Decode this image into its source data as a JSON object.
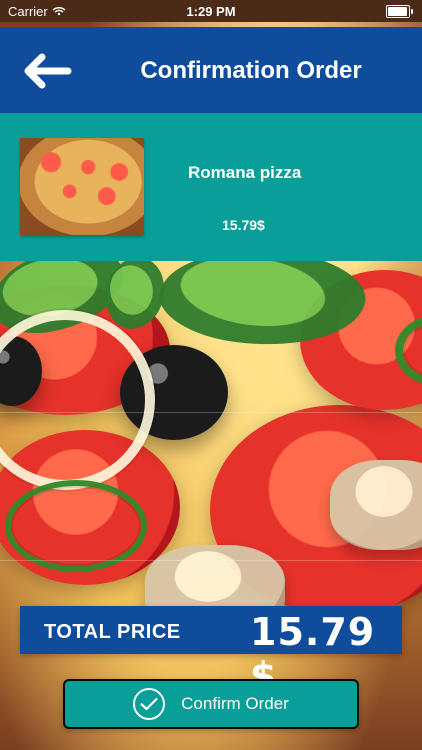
{
  "status_bar": {
    "carrier": "Carrier",
    "time": "1:29 PM",
    "icons": [
      "wifi-icon",
      "battery-icon"
    ]
  },
  "header": {
    "title": "Confirmation Order",
    "back_icon": "back-arrow-icon"
  },
  "order": {
    "items": [
      {
        "name": "Romana pizza",
        "price": "15.79$"
      }
    ],
    "total_label": "TOTAL  PRICE",
    "total_value": "15.79 $"
  },
  "actions": {
    "confirm_label": "Confirm Order",
    "confirm_icon": "check-circle-icon"
  },
  "colors": {
    "header_blue": "#0f4c9b",
    "teal": "#0a9e98"
  }
}
